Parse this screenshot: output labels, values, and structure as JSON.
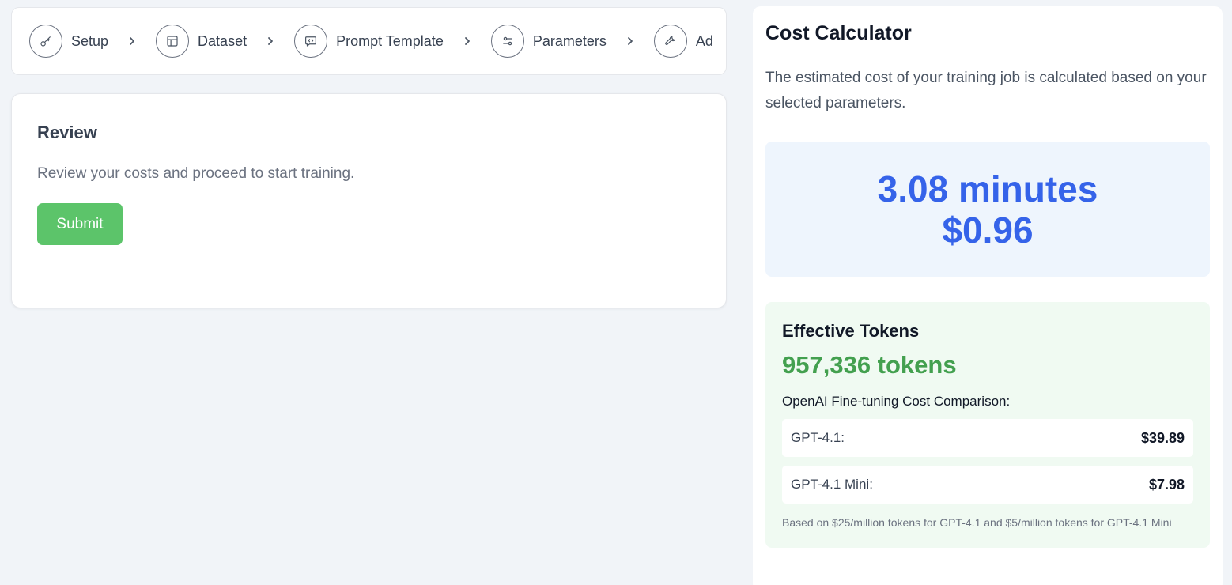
{
  "stepper": {
    "steps": [
      {
        "label": "Setup",
        "icon": "key-icon"
      },
      {
        "label": "Dataset",
        "icon": "table-icon"
      },
      {
        "label": "Prompt Template",
        "icon": "message-code-icon"
      },
      {
        "label": "Parameters",
        "icon": "sliders-icon"
      },
      {
        "label": "Ad",
        "icon": "wrench-icon"
      }
    ]
  },
  "review": {
    "title": "Review",
    "description": "Review your costs and proceed to start training.",
    "submit_label": "Submit"
  },
  "calculator": {
    "title": "Cost Calculator",
    "description": "The estimated cost of your training job is calculated based on your selected parameters.",
    "estimate_time": "3.08 minutes",
    "estimate_cost": "$0.96",
    "tokens_title": "Effective Tokens",
    "tokens_value": "957,336 tokens",
    "comparison_title": "OpenAI Fine-tuning Cost Comparison:",
    "comparison": [
      {
        "model": "GPT-4.1:",
        "price": "$39.89"
      },
      {
        "model": "GPT-4.1 Mini:",
        "price": "$7.98"
      }
    ],
    "footnote": "Based on $25/million tokens for GPT-4.1 and $5/million tokens for GPT-4.1 Mini"
  },
  "colors": {
    "accent_blue": "#3563e9",
    "accent_green": "#43a04f",
    "submit_green": "#5cc46a"
  }
}
